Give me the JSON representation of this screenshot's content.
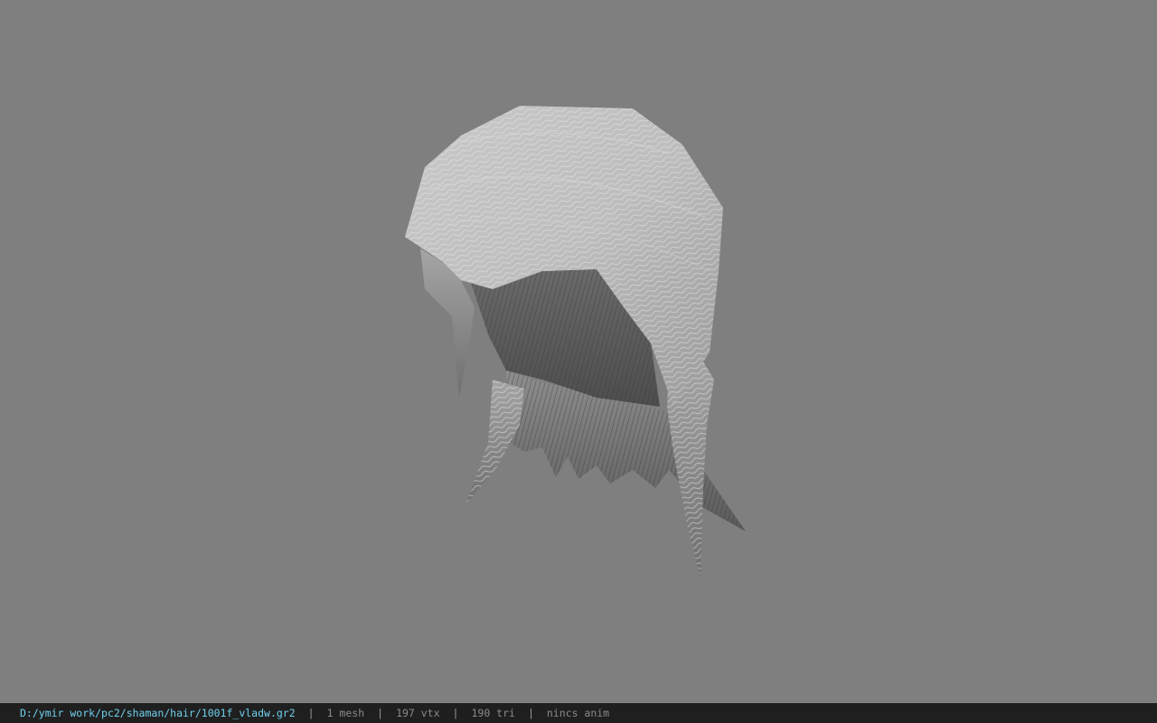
{
  "viewport": {
    "background_color": "#7f7f7f",
    "model_icon": "hair-mesh-preview"
  },
  "status_bar": {
    "file_path": "D:/ymir work/pc2/shaman/hair/1001f_vladw.gr2",
    "separator": "|",
    "mesh_count": "1 mesh",
    "vertex_count": "197 vtx",
    "triangle_count": "190 tri",
    "animation_status": "nincs anim",
    "path_color": "#6fd0ee",
    "background_color": "#1f1f1f"
  }
}
